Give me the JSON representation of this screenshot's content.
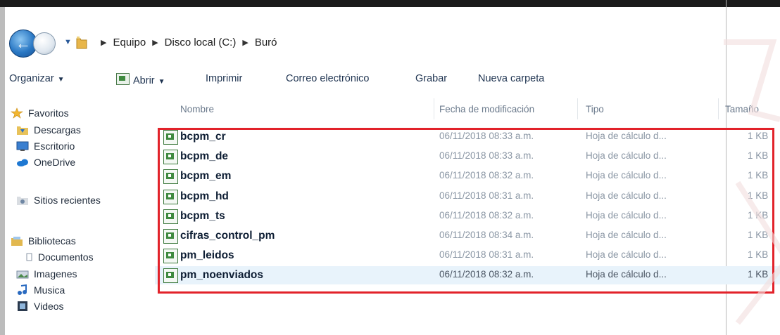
{
  "address_bar": {
    "breadcrumbs": [
      "Equipo",
      "Disco local (C:)",
      "Buró"
    ]
  },
  "toolbar": {
    "organize": "Organizar",
    "open": "Abrir",
    "print": "Imprimir",
    "email": "Correo electrónico",
    "burn": "Grabar",
    "new_folder": "Nueva carpeta"
  },
  "nav_pane": {
    "favorites": "Favoritos",
    "favorites_items": [
      "Descargas",
      "Escritorio",
      "OneDrive",
      "Sitios recientes"
    ],
    "libraries": "Bibliotecas",
    "libraries_items": [
      "Documentos",
      "Imagenes",
      "Musica",
      "Videos"
    ]
  },
  "columns": {
    "name": "Nombre",
    "date": "Fecha de modificación",
    "type": "Tipo",
    "size": "Tamaño"
  },
  "files": [
    {
      "name": "bcpm_cr",
      "date": "06/11/2018 08:33 a.m.",
      "type": "Hoja de cálculo d...",
      "size": "1 KB"
    },
    {
      "name": "bcpm_de",
      "date": "06/11/2018 08:33 a.m.",
      "type": "Hoja de cálculo d...",
      "size": "1 KB"
    },
    {
      "name": "bcpm_em",
      "date": "06/11/2018 08:32 a.m.",
      "type": "Hoja de cálculo d...",
      "size": "1 KB"
    },
    {
      "name": "bcpm_hd",
      "date": "06/11/2018 08:31 a.m.",
      "type": "Hoja de cálculo d...",
      "size": "1 KB"
    },
    {
      "name": "bcpm_ts",
      "date": "06/11/2018 08:32 a.m.",
      "type": "Hoja de cálculo d...",
      "size": "1 KB"
    },
    {
      "name": "cifras_control_pm",
      "date": "06/11/2018 08:34 a.m.",
      "type": "Hoja de cálculo d...",
      "size": "1 KB"
    },
    {
      "name": "pm_leidos",
      "date": "06/11/2018 08:31 a.m.",
      "type": "Hoja de cálculo d...",
      "size": "1 KB"
    },
    {
      "name": "pm_noenviados",
      "date": "06/11/2018 08:32 a.m.",
      "type": "Hoja de cálculo d...",
      "size": "1 KB"
    }
  ],
  "colors": {
    "highlight": "#e2222a",
    "selection": "#e8f3fb"
  }
}
